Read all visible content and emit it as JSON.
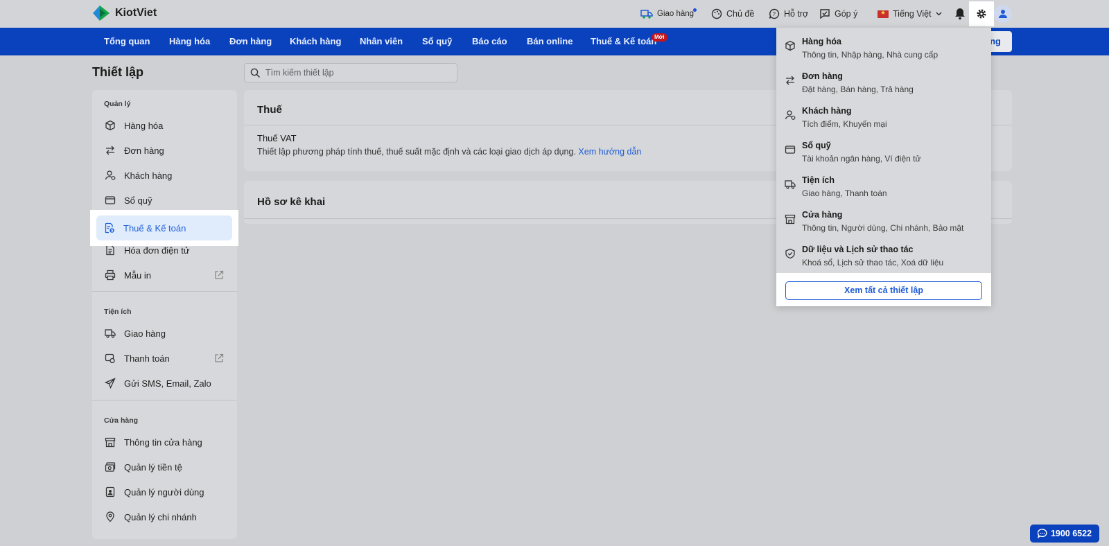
{
  "app": {
    "name": "KiotViet"
  },
  "top": {
    "delivery": "Giao hàng",
    "theme": "Chủ đề",
    "support": "Hỗ trợ",
    "feedback": "Góp ý",
    "language": "Tiếng Việt"
  },
  "nav": {
    "items": [
      "Tổng quan",
      "Hàng hóa",
      "Đơn hàng",
      "Khách hàng",
      "Nhân viên",
      "Sổ quỹ",
      "Báo cáo",
      "Bán online",
      "Thuế & Kế toán"
    ],
    "new_badge": "Mới",
    "right_btn": "ng"
  },
  "page": {
    "title": "Thiết lập",
    "search_placeholder": "Tìm kiếm thiết lập"
  },
  "sidebar": {
    "manage_label": "Quản lý",
    "manage": [
      "Hàng hóa",
      "Đơn hàng",
      "Khách hàng",
      "Sổ quỹ",
      "Thuế & Kế toán",
      "Hóa đơn điện tử",
      "Mẫu in"
    ],
    "utilities_label": "Tiện ích",
    "utilities": [
      "Giao hàng",
      "Thanh toán",
      "Gửi SMS, Email, Zalo"
    ],
    "store_label": "Cửa hàng",
    "store": [
      "Thông tin cửa hàng",
      "Quản lý tiền tệ",
      "Quản lý người dùng",
      "Quản lý chi nhánh"
    ]
  },
  "tax": {
    "title": "Thuế",
    "vat_title": "Thuế VAT",
    "vat_desc": "Thiết lập phương pháp tính thuế, thuế suất mặc định và các loại giao dịch áp dụng.",
    "vat_link": "Xem hướng dẫn"
  },
  "filing": {
    "title": "Hồ sơ kê khai"
  },
  "dropdown": {
    "items": [
      {
        "title": "Hàng hóa",
        "sub": "Thông tin, Nhập hàng, Nhà cung cấp"
      },
      {
        "title": "Đơn hàng",
        "sub": "Đặt hàng, Bán hàng, Trả hàng"
      },
      {
        "title": "Khách hàng",
        "sub": "Tích điểm, Khuyến mại"
      },
      {
        "title": "Sổ quỹ",
        "sub": "Tài khoản ngân hàng, Ví điện tử"
      },
      {
        "title": "Tiện ích",
        "sub": "Giao hàng, Thanh toán"
      },
      {
        "title": "Cửa hàng",
        "sub": "Thông tin, Người dùng, Chi nhánh, Bảo mật"
      },
      {
        "title": "Dữ liệu và Lịch sử thao tác",
        "sub": "Khoá sổ, Lịch sử thao tác, Xoá dữ liệu"
      }
    ],
    "view_all": "Xem tất cả thiết lập"
  },
  "hotline": "1900 6522",
  "colors": {
    "primary": "#0a42bd",
    "link": "#1d5bd6",
    "active_bg": "#e0ebfb",
    "badge": "#c4161c"
  }
}
